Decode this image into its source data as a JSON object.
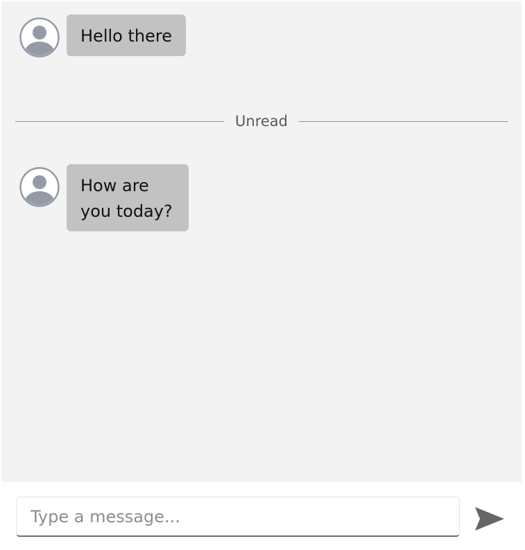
{
  "chat": {
    "messages": [
      {
        "text": "Hello there"
      },
      {
        "text": "How are you today?"
      }
    ],
    "divider_label": "Unread"
  },
  "composer": {
    "placeholder": "Type a message...",
    "value": "",
    "send_icon": "send-icon"
  },
  "colors": {
    "chat_background": "#f3f3f3",
    "bubble": "#c2c2c2",
    "avatar": "#939ba6",
    "send_icon": "#666666"
  }
}
